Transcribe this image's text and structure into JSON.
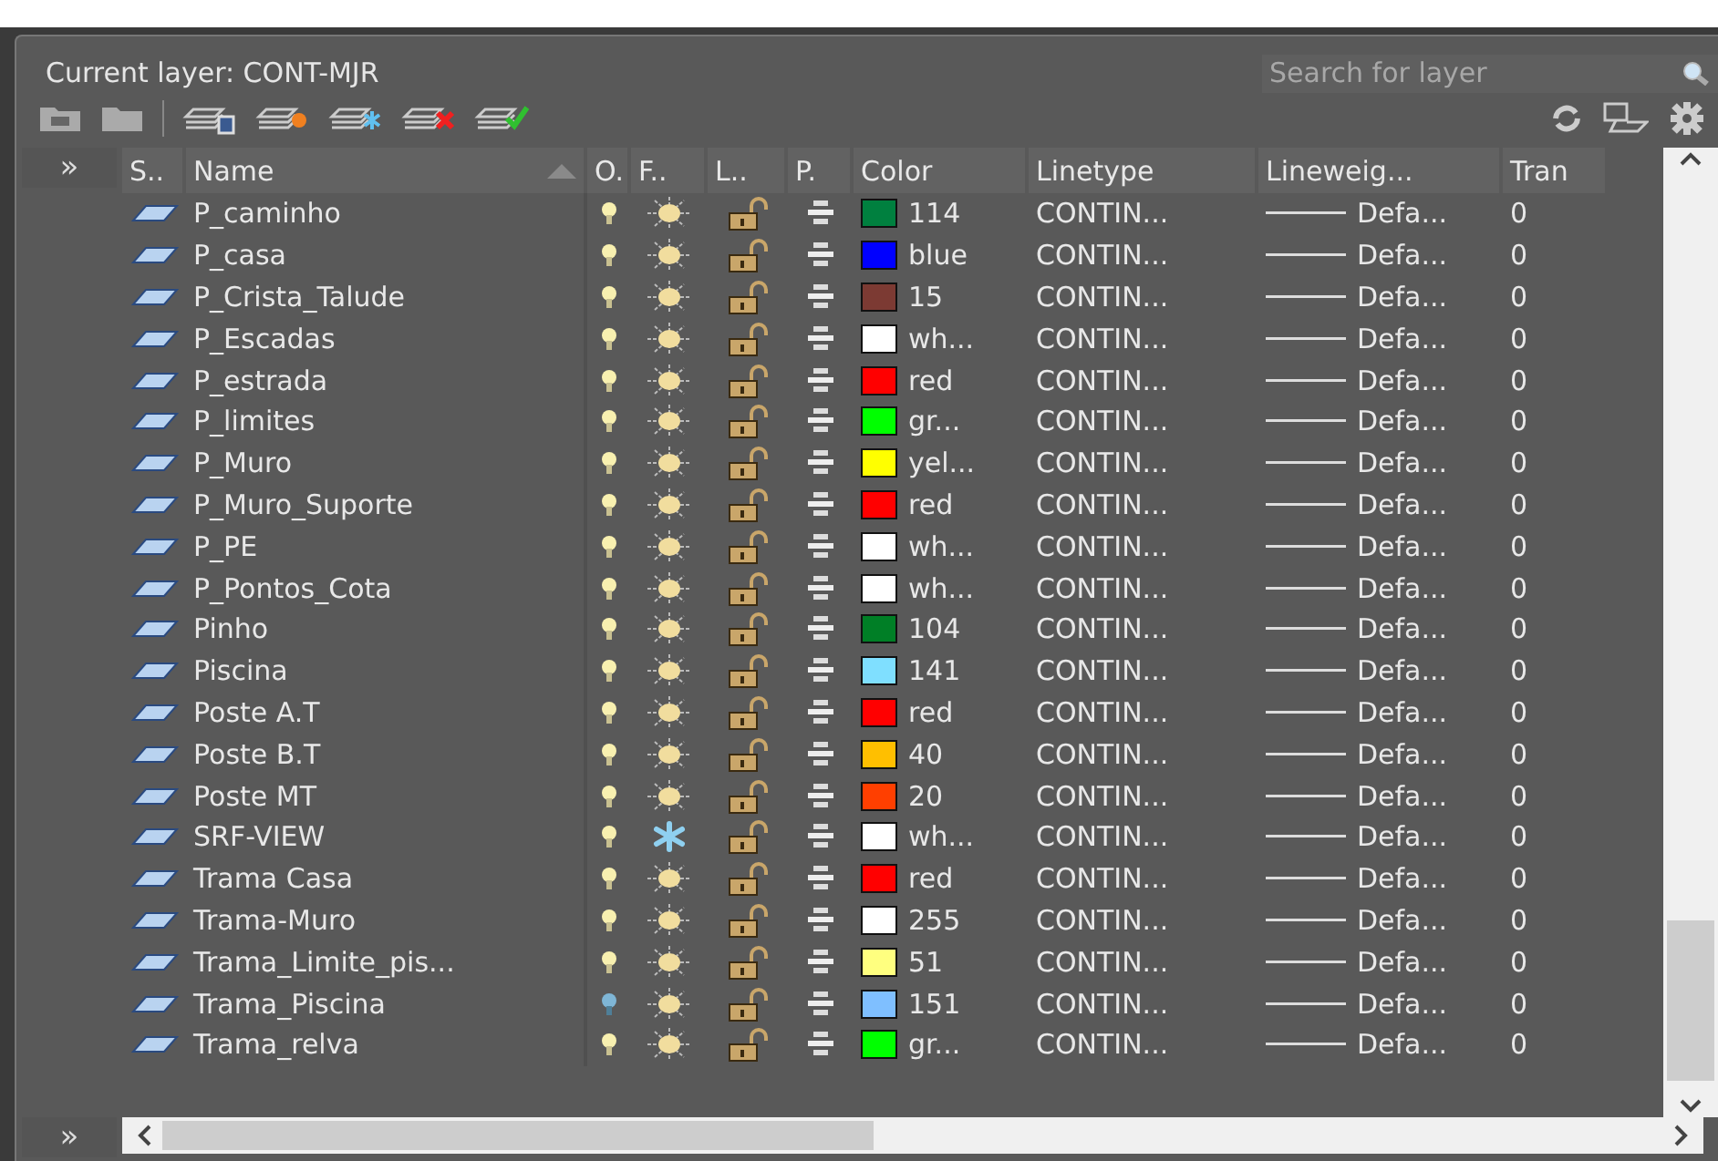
{
  "current_layer": {
    "label": "Current layer: CONT-MJR"
  },
  "search": {
    "placeholder": "Search for layer"
  },
  "sidebar": {
    "expand_top": "»",
    "expand_bottom": "»"
  },
  "table": {
    "columns": [
      "S..",
      "Name",
      "O.",
      "F..",
      "L..",
      "P.",
      "Color",
      "Linetype",
      "Lineweig...",
      "Tran"
    ],
    "rows": [
      {
        "name": "P_caminho",
        "on": true,
        "frozen": false,
        "locked": false,
        "plot": true,
        "color": "#00803f",
        "color_label": "114",
        "linetype": "CONTIN...",
        "lineweight": "Defa...",
        "transparency": "0"
      },
      {
        "name": "P_casa",
        "on": true,
        "frozen": false,
        "locked": false,
        "plot": true,
        "color": "#0000ff",
        "color_label": "blue",
        "linetype": "CONTIN...",
        "lineweight": "Defa...",
        "transparency": "0"
      },
      {
        "name": "P_Crista_Talude",
        "on": true,
        "frozen": false,
        "locked": false,
        "plot": true,
        "color": "#7c3a33",
        "color_label": "15",
        "linetype": "CONTIN...",
        "lineweight": "Defa...",
        "transparency": "0"
      },
      {
        "name": "P_Escadas",
        "on": true,
        "frozen": false,
        "locked": false,
        "plot": true,
        "color": "#ffffff",
        "color_label": "wh...",
        "linetype": "CONTIN...",
        "lineweight": "Defa...",
        "transparency": "0"
      },
      {
        "name": "P_estrada",
        "on": true,
        "frozen": false,
        "locked": false,
        "plot": true,
        "color": "#ff0000",
        "color_label": "red",
        "linetype": "CONTIN...",
        "lineweight": "Defa...",
        "transparency": "0"
      },
      {
        "name": "P_limites",
        "on": true,
        "frozen": false,
        "locked": false,
        "plot": true,
        "color": "#00ff00",
        "color_label": "gr...",
        "linetype": "CONTIN...",
        "lineweight": "Defa...",
        "transparency": "0"
      },
      {
        "name": "P_Muro",
        "on": true,
        "frozen": false,
        "locked": false,
        "plot": true,
        "color": "#ffff00",
        "color_label": "yel...",
        "linetype": "CONTIN...",
        "lineweight": "Defa...",
        "transparency": "0"
      },
      {
        "name": "P_Muro_Suporte",
        "on": true,
        "frozen": false,
        "locked": false,
        "plot": true,
        "color": "#ff0000",
        "color_label": "red",
        "linetype": "CONTIN...",
        "lineweight": "Defa...",
        "transparency": "0"
      },
      {
        "name": "P_PE",
        "on": true,
        "frozen": false,
        "locked": false,
        "plot": true,
        "color": "#ffffff",
        "color_label": "wh...",
        "linetype": "CONTIN...",
        "lineweight": "Defa...",
        "transparency": "0"
      },
      {
        "name": "P_Pontos_Cota",
        "on": true,
        "frozen": false,
        "locked": false,
        "plot": true,
        "color": "#ffffff",
        "color_label": "wh...",
        "linetype": "CONTIN...",
        "lineweight": "Defa...",
        "transparency": "0"
      },
      {
        "name": "Pinho",
        "on": true,
        "frozen": false,
        "locked": false,
        "plot": true,
        "color": "#007f26",
        "color_label": "104",
        "linetype": "CONTIN...",
        "lineweight": "Defa...",
        "transparency": "0"
      },
      {
        "name": "Piscina",
        "on": true,
        "frozen": false,
        "locked": false,
        "plot": true,
        "color": "#7fdfff",
        "color_label": "141",
        "linetype": "CONTIN...",
        "lineweight": "Defa...",
        "transparency": "0"
      },
      {
        "name": "Poste A.T",
        "on": true,
        "frozen": false,
        "locked": false,
        "plot": true,
        "color": "#ff0000",
        "color_label": "red",
        "linetype": "CONTIN...",
        "lineweight": "Defa...",
        "transparency": "0"
      },
      {
        "name": "Poste B.T",
        "on": true,
        "frozen": false,
        "locked": false,
        "plot": true,
        "color": "#ffbf00",
        "color_label": "40",
        "linetype": "CONTIN...",
        "lineweight": "Defa...",
        "transparency": "0"
      },
      {
        "name": "Poste MT",
        "on": true,
        "frozen": false,
        "locked": false,
        "plot": true,
        "color": "#ff3f00",
        "color_label": "20",
        "linetype": "CONTIN...",
        "lineweight": "Defa...",
        "transparency": "0"
      },
      {
        "name": "SRF-VIEW",
        "on": true,
        "frozen": true,
        "locked": false,
        "plot": true,
        "color": "#ffffff",
        "color_label": "wh...",
        "linetype": "CONTIN...",
        "lineweight": "Defa...",
        "transparency": "0"
      },
      {
        "name": "Trama Casa",
        "on": true,
        "frozen": false,
        "locked": false,
        "plot": true,
        "color": "#ff0000",
        "color_label": "red",
        "linetype": "CONTIN...",
        "lineweight": "Defa...",
        "transparency": "0"
      },
      {
        "name": "Trama-Muro",
        "on": true,
        "frozen": false,
        "locked": false,
        "plot": true,
        "color": "#ffffff",
        "color_label": "255",
        "linetype": "CONTIN...",
        "lineweight": "Defa...",
        "transparency": "0"
      },
      {
        "name": "Trama_Limite_pis...",
        "on": true,
        "frozen": false,
        "locked": false,
        "plot": true,
        "color": "#ffff7f",
        "color_label": "51",
        "linetype": "CONTIN...",
        "lineweight": "Defa...",
        "transparency": "0"
      },
      {
        "name": "Trama_Piscina",
        "on": false,
        "frozen": false,
        "locked": false,
        "plot": true,
        "color": "#7fbfff",
        "color_label": "151",
        "linetype": "CONTIN...",
        "lineweight": "Defa...",
        "transparency": "0"
      },
      {
        "name": "Trama_relva",
        "on": true,
        "frozen": false,
        "locked": false,
        "plot": true,
        "color": "#00ff00",
        "color_label": "gr...",
        "linetype": "CONTIN...",
        "lineweight": "Defa...",
        "transparency": "0"
      }
    ]
  }
}
